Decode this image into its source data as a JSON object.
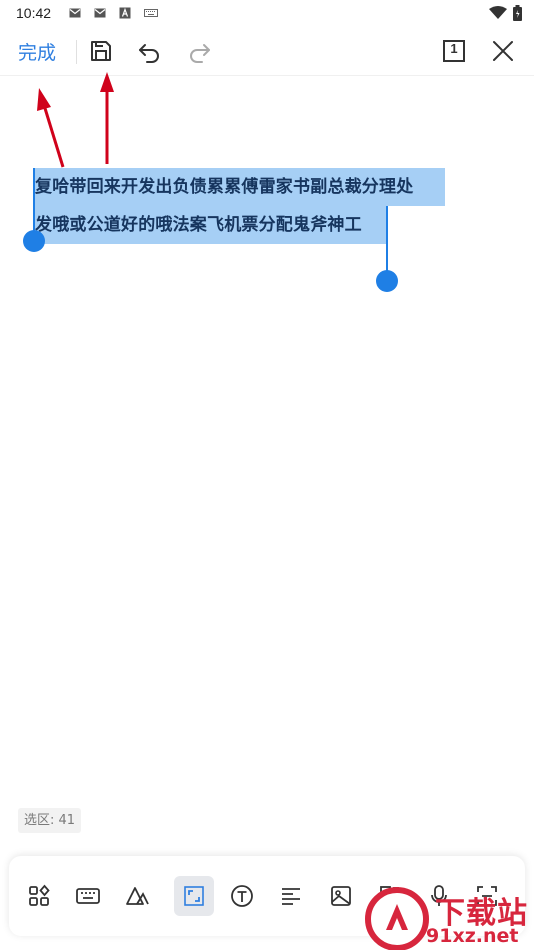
{
  "status_bar": {
    "time": "10:42",
    "icons": [
      "mail-icon",
      "mail-icon",
      "font-a-icon",
      "keyboard-icon"
    ],
    "right_icons": [
      "wifi-icon",
      "battery-icon"
    ]
  },
  "toolbar": {
    "done_label": "完成",
    "icons": [
      "save-icon",
      "undo-icon",
      "redo-icon",
      "page-one-icon",
      "close-icon"
    ],
    "page_badge": "1"
  },
  "selection": {
    "line1": "复哈带回来开发出负债累累傅雷家书副总裁分理处",
    "line2": "发哦或公道好的哦法案飞机票分配鬼斧神工",
    "highlight_color": "#a6cff5",
    "handle_color": "#1f7fe5"
  },
  "annotation": {
    "arrow_color": "#d0021b"
  },
  "selection_count": "选区: 41",
  "bottom_bar": {
    "icons": [
      "layout-grid-icon",
      "keyboard-icon",
      "shape-icon",
      "select-frame-icon",
      "text-icon",
      "align-icon",
      "image-icon",
      "convert-icon",
      "mic-icon",
      "scan-icon"
    ],
    "active": "select-frame-icon"
  },
  "watermark": {
    "top": "下载站",
    "bottom": "91xz.net"
  }
}
